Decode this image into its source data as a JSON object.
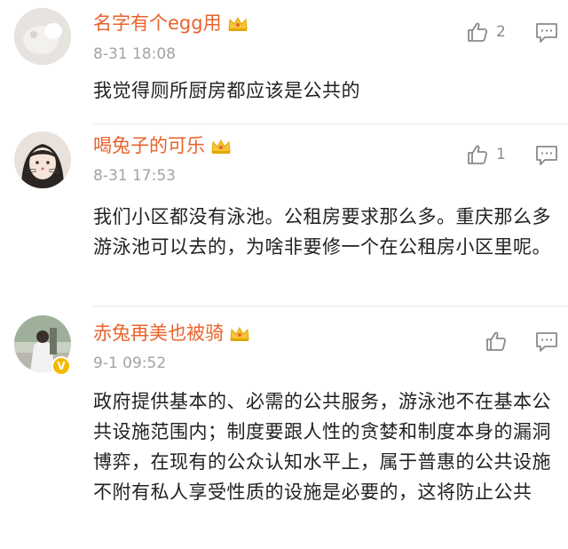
{
  "comments": [
    {
      "username": "名字有个egg用",
      "timestamp": "8-31 18:08",
      "text": "我觉得厕所厨房都应该是公共的",
      "like_count": "2"
    },
    {
      "username": "喝兔子的可乐",
      "timestamp": "8-31 17:53",
      "text": "我们小区都没有泳池。公租房要求那么多。重庆那么多游泳池可以去的，为啥非要修一个在公租房小区里呢。",
      "like_count": "1"
    },
    {
      "username": "赤兔再美也被骑",
      "timestamp": "9-1 09:52",
      "text": "政府提供基本的、必需的公共服务，游泳池不在基本公共设施范围内；制度要跟人性的贪婪和制度本身的漏洞博弈，在现有的公众认知水平上，属于普惠的公共设施不附有私人享受性质的设施是必要的，这将防止公共",
      "like_count": "",
      "verified_badge": "V"
    }
  ],
  "colors": {
    "username": "#e8632b",
    "timestamp": "#a3a3a3",
    "text": "#222222",
    "badge": "#f5b800"
  }
}
